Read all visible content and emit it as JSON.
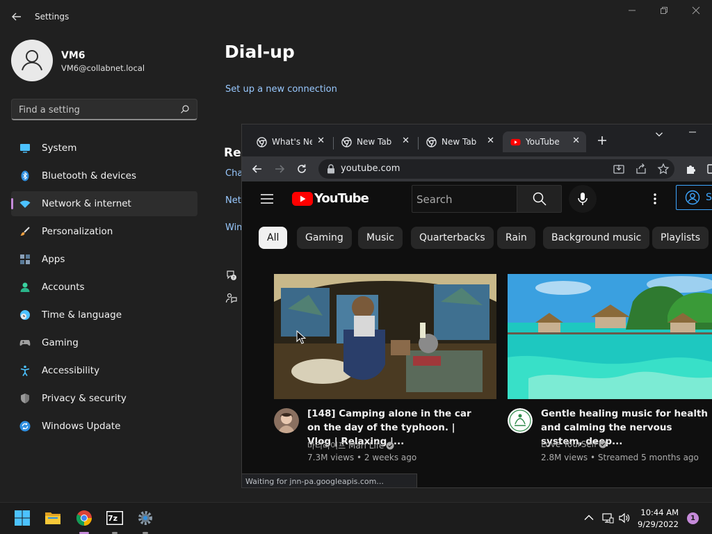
{
  "settings": {
    "app_title": "Settings",
    "profile": {
      "name": "VM6",
      "email": "VM6@collabnet.local"
    },
    "search_placeholder": "Find a setting",
    "nav": [
      {
        "label": "System",
        "icon": "monitor-icon",
        "color": "#4cc2ff"
      },
      {
        "label": "Bluetooth & devices",
        "icon": "bluetooth-icon",
        "color": "#4cc2ff"
      },
      {
        "label": "Network & internet",
        "icon": "wifi-icon",
        "color": "#4cc2ff",
        "active": true
      },
      {
        "label": "Personalization",
        "icon": "brush-icon",
        "color": "#f0a040"
      },
      {
        "label": "Apps",
        "icon": "apps-icon",
        "color": "#8aa0b8"
      },
      {
        "label": "Accounts",
        "icon": "person-icon",
        "color": "#3ad29f"
      },
      {
        "label": "Time & language",
        "icon": "clock-globe-icon",
        "color": "#4cc2ff"
      },
      {
        "label": "Gaming",
        "icon": "gamepad-icon",
        "color": "#9a9a9a"
      },
      {
        "label": "Accessibility",
        "icon": "accessibility-icon",
        "color": "#4cc2ff"
      },
      {
        "label": "Privacy & security",
        "icon": "shield-icon",
        "color": "#9a9a9a"
      },
      {
        "label": "Windows Update",
        "icon": "update-icon",
        "color": "#4cc2ff"
      }
    ],
    "page_title": "Dial-up",
    "setup_link": "Set up a new connection",
    "related_heading": "Rel",
    "related_links": [
      "Cha",
      "Netw",
      "Win"
    ]
  },
  "chrome": {
    "tabs": [
      {
        "title": "What's New",
        "favicon": "chrome-icon"
      },
      {
        "title": "New Tab",
        "favicon": "chrome-icon"
      },
      {
        "title": "New Tab",
        "favicon": "chrome-icon"
      },
      {
        "title": "YouTube",
        "favicon": "youtube-icon",
        "active": true
      }
    ],
    "url": "youtube.com",
    "status_text": "Waiting for jnn-pa.googleapis.com..."
  },
  "youtube": {
    "logo_text": "YouTube",
    "search_placeholder": "Search",
    "signin_label": "S",
    "chips": [
      "All",
      "Gaming",
      "Music",
      "Quarterbacks",
      "Rain",
      "Background music",
      "Playlists"
    ],
    "videos": [
      {
        "title": "[148] Camping alone in the car on the day of the typhoon. | Vlog | Relaxing |...",
        "channel": "마리라이프 Mari Life",
        "views": "7.3M views",
        "age": "2 weeks ago"
      },
      {
        "title": "Gentle healing music for health and calming the nervous system, deep...",
        "channel": "Love YourSelf",
        "views": "2.8M views",
        "age": "Streamed 5 months ago"
      }
    ]
  },
  "taskbar": {
    "time": "10:44 AM",
    "date": "9/29/2022",
    "notification_count": "1",
    "archiver_label": "7z"
  },
  "colors": {
    "accent": "#c58ad9",
    "link": "#99c9ff",
    "youtube_red": "#ff0000"
  }
}
